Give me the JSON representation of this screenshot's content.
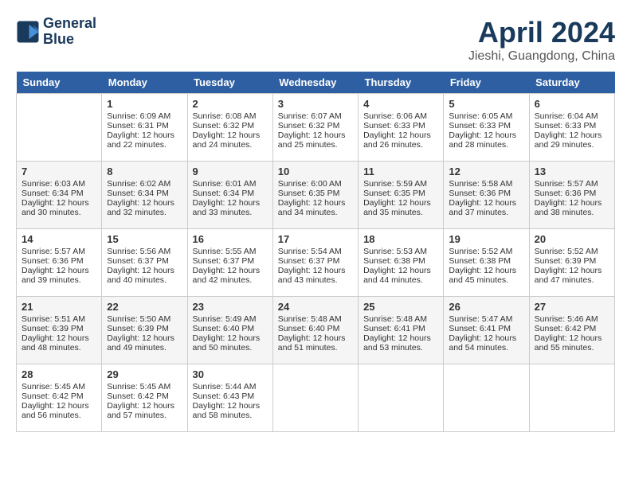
{
  "header": {
    "logo_line1": "General",
    "logo_line2": "Blue",
    "title": "April 2024",
    "location": "Jieshi, Guangdong, China"
  },
  "weekdays": [
    "Sunday",
    "Monday",
    "Tuesday",
    "Wednesday",
    "Thursday",
    "Friday",
    "Saturday"
  ],
  "weeks": [
    [
      {
        "day": "",
        "sunrise": "",
        "sunset": "",
        "daylight": ""
      },
      {
        "day": "1",
        "sunrise": "Sunrise: 6:09 AM",
        "sunset": "Sunset: 6:31 PM",
        "daylight": "Daylight: 12 hours and 22 minutes."
      },
      {
        "day": "2",
        "sunrise": "Sunrise: 6:08 AM",
        "sunset": "Sunset: 6:32 PM",
        "daylight": "Daylight: 12 hours and 24 minutes."
      },
      {
        "day": "3",
        "sunrise": "Sunrise: 6:07 AM",
        "sunset": "Sunset: 6:32 PM",
        "daylight": "Daylight: 12 hours and 25 minutes."
      },
      {
        "day": "4",
        "sunrise": "Sunrise: 6:06 AM",
        "sunset": "Sunset: 6:33 PM",
        "daylight": "Daylight: 12 hours and 26 minutes."
      },
      {
        "day": "5",
        "sunrise": "Sunrise: 6:05 AM",
        "sunset": "Sunset: 6:33 PM",
        "daylight": "Daylight: 12 hours and 28 minutes."
      },
      {
        "day": "6",
        "sunrise": "Sunrise: 6:04 AM",
        "sunset": "Sunset: 6:33 PM",
        "daylight": "Daylight: 12 hours and 29 minutes."
      }
    ],
    [
      {
        "day": "7",
        "sunrise": "Sunrise: 6:03 AM",
        "sunset": "Sunset: 6:34 PM",
        "daylight": "Daylight: 12 hours and 30 minutes."
      },
      {
        "day": "8",
        "sunrise": "Sunrise: 6:02 AM",
        "sunset": "Sunset: 6:34 PM",
        "daylight": "Daylight: 12 hours and 32 minutes."
      },
      {
        "day": "9",
        "sunrise": "Sunrise: 6:01 AM",
        "sunset": "Sunset: 6:34 PM",
        "daylight": "Daylight: 12 hours and 33 minutes."
      },
      {
        "day": "10",
        "sunrise": "Sunrise: 6:00 AM",
        "sunset": "Sunset: 6:35 PM",
        "daylight": "Daylight: 12 hours and 34 minutes."
      },
      {
        "day": "11",
        "sunrise": "Sunrise: 5:59 AM",
        "sunset": "Sunset: 6:35 PM",
        "daylight": "Daylight: 12 hours and 35 minutes."
      },
      {
        "day": "12",
        "sunrise": "Sunrise: 5:58 AM",
        "sunset": "Sunset: 6:36 PM",
        "daylight": "Daylight: 12 hours and 37 minutes."
      },
      {
        "day": "13",
        "sunrise": "Sunrise: 5:57 AM",
        "sunset": "Sunset: 6:36 PM",
        "daylight": "Daylight: 12 hours and 38 minutes."
      }
    ],
    [
      {
        "day": "14",
        "sunrise": "Sunrise: 5:57 AM",
        "sunset": "Sunset: 6:36 PM",
        "daylight": "Daylight: 12 hours and 39 minutes."
      },
      {
        "day": "15",
        "sunrise": "Sunrise: 5:56 AM",
        "sunset": "Sunset: 6:37 PM",
        "daylight": "Daylight: 12 hours and 40 minutes."
      },
      {
        "day": "16",
        "sunrise": "Sunrise: 5:55 AM",
        "sunset": "Sunset: 6:37 PM",
        "daylight": "Daylight: 12 hours and 42 minutes."
      },
      {
        "day": "17",
        "sunrise": "Sunrise: 5:54 AM",
        "sunset": "Sunset: 6:37 PM",
        "daylight": "Daylight: 12 hours and 43 minutes."
      },
      {
        "day": "18",
        "sunrise": "Sunrise: 5:53 AM",
        "sunset": "Sunset: 6:38 PM",
        "daylight": "Daylight: 12 hours and 44 minutes."
      },
      {
        "day": "19",
        "sunrise": "Sunrise: 5:52 AM",
        "sunset": "Sunset: 6:38 PM",
        "daylight": "Daylight: 12 hours and 45 minutes."
      },
      {
        "day": "20",
        "sunrise": "Sunrise: 5:52 AM",
        "sunset": "Sunset: 6:39 PM",
        "daylight": "Daylight: 12 hours and 47 minutes."
      }
    ],
    [
      {
        "day": "21",
        "sunrise": "Sunrise: 5:51 AM",
        "sunset": "Sunset: 6:39 PM",
        "daylight": "Daylight: 12 hours and 48 minutes."
      },
      {
        "day": "22",
        "sunrise": "Sunrise: 5:50 AM",
        "sunset": "Sunset: 6:39 PM",
        "daylight": "Daylight: 12 hours and 49 minutes."
      },
      {
        "day": "23",
        "sunrise": "Sunrise: 5:49 AM",
        "sunset": "Sunset: 6:40 PM",
        "daylight": "Daylight: 12 hours and 50 minutes."
      },
      {
        "day": "24",
        "sunrise": "Sunrise: 5:48 AM",
        "sunset": "Sunset: 6:40 PM",
        "daylight": "Daylight: 12 hours and 51 minutes."
      },
      {
        "day": "25",
        "sunrise": "Sunrise: 5:48 AM",
        "sunset": "Sunset: 6:41 PM",
        "daylight": "Daylight: 12 hours and 53 minutes."
      },
      {
        "day": "26",
        "sunrise": "Sunrise: 5:47 AM",
        "sunset": "Sunset: 6:41 PM",
        "daylight": "Daylight: 12 hours and 54 minutes."
      },
      {
        "day": "27",
        "sunrise": "Sunrise: 5:46 AM",
        "sunset": "Sunset: 6:42 PM",
        "daylight": "Daylight: 12 hours and 55 minutes."
      }
    ],
    [
      {
        "day": "28",
        "sunrise": "Sunrise: 5:45 AM",
        "sunset": "Sunset: 6:42 PM",
        "daylight": "Daylight: 12 hours and 56 minutes."
      },
      {
        "day": "29",
        "sunrise": "Sunrise: 5:45 AM",
        "sunset": "Sunset: 6:42 PM",
        "daylight": "Daylight: 12 hours and 57 minutes."
      },
      {
        "day": "30",
        "sunrise": "Sunrise: 5:44 AM",
        "sunset": "Sunset: 6:43 PM",
        "daylight": "Daylight: 12 hours and 58 minutes."
      },
      {
        "day": "",
        "sunrise": "",
        "sunset": "",
        "daylight": ""
      },
      {
        "day": "",
        "sunrise": "",
        "sunset": "",
        "daylight": ""
      },
      {
        "day": "",
        "sunrise": "",
        "sunset": "",
        "daylight": ""
      },
      {
        "day": "",
        "sunrise": "",
        "sunset": "",
        "daylight": ""
      }
    ]
  ]
}
